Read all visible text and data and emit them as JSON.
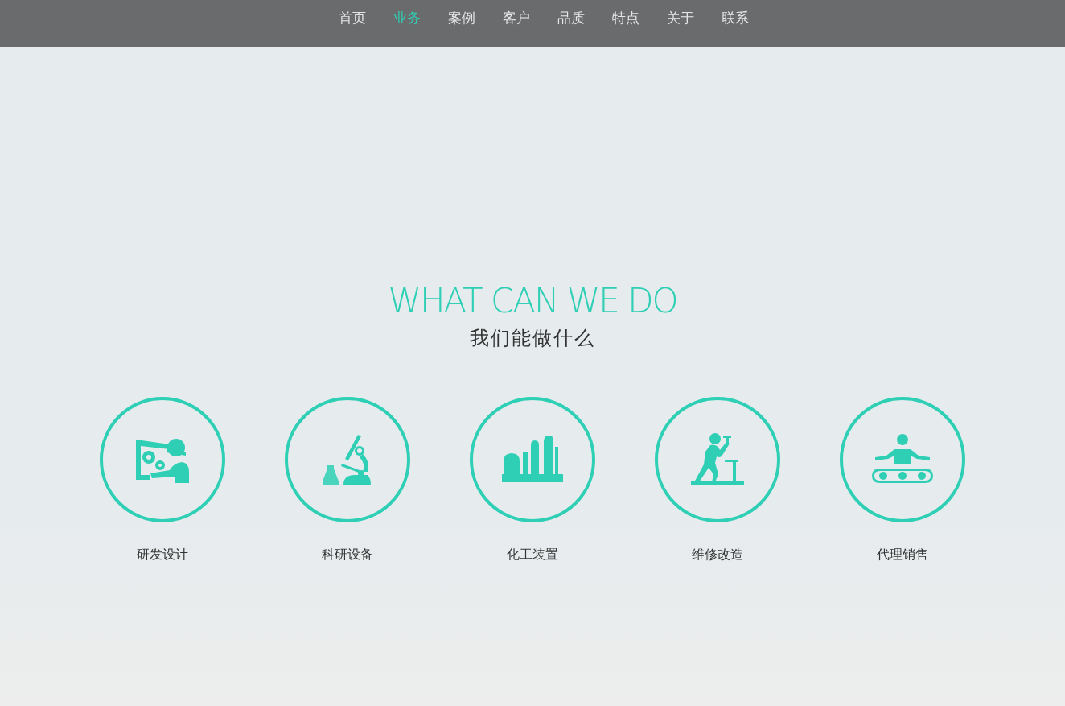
{
  "nav": [
    {
      "label": "首页",
      "selected": false
    },
    {
      "label": "业务",
      "selected": true
    },
    {
      "label": "案例",
      "selected": false
    },
    {
      "label": "客户",
      "selected": false
    },
    {
      "label": "品质",
      "selected": false
    },
    {
      "label": "特点",
      "selected": false
    },
    {
      "label": "关于",
      "selected": false
    },
    {
      "label": "联系",
      "selected": false
    }
  ],
  "section": {
    "title": "WHAT CAN WE DO",
    "subtitle": "我们能做什么"
  },
  "services": [
    {
      "kind": "design",
      "label": "研发设计"
    },
    {
      "kind": "lab",
      "label": "科研设备"
    },
    {
      "kind": "plant",
      "label": "化工装置"
    },
    {
      "kind": "repair",
      "label": "维修改造"
    },
    {
      "kind": "sales",
      "label": "代理销售"
    }
  ]
}
